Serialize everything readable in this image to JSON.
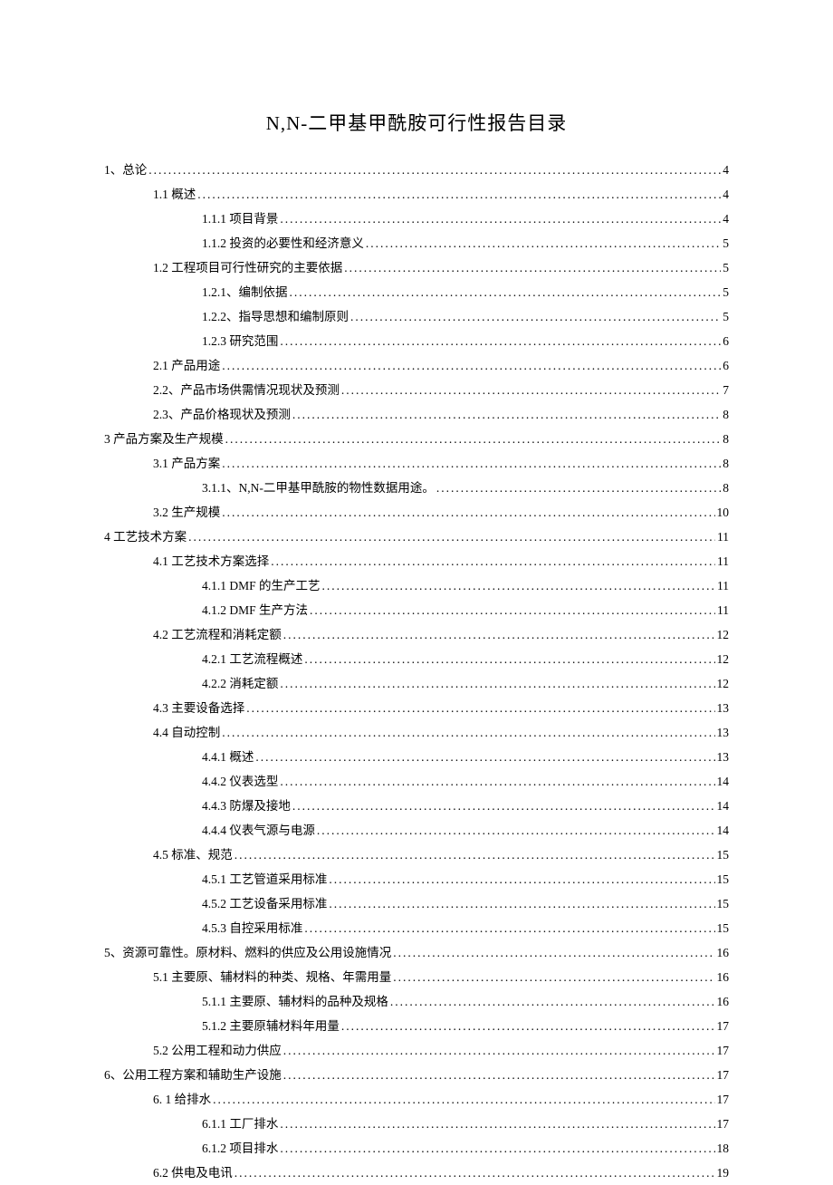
{
  "title": "N,N-二甲基甲酰胺可行性报告目录",
  "toc": [
    {
      "level": 0,
      "label": "1、总论",
      "page": "4"
    },
    {
      "level": 1,
      "label": "1.1 概述",
      "page": "4"
    },
    {
      "level": 2,
      "label": "1.1.1 项目背景",
      "page": "4"
    },
    {
      "level": 2,
      "label": "1.1.2 投资的必要性和经济意义",
      "page": "5"
    },
    {
      "level": 1,
      "label": "1.2 工程项目可行性研究的主要依据",
      "page": "5"
    },
    {
      "level": 2,
      "label": "1.2.1、编制依据",
      "page": "5"
    },
    {
      "level": 2,
      "label": "1.2.2、指导思想和编制原则",
      "page": "5"
    },
    {
      "level": 2,
      "label": "1.2.3  研究范围",
      "page": "6"
    },
    {
      "level": 1,
      "label": "2.1 产品用途",
      "page": "6"
    },
    {
      "level": 1,
      "label": "2.2、产品市场供需情况现状及预测",
      "page": "7"
    },
    {
      "level": 1,
      "label": "2.3、产品价格现状及预测",
      "page": "8"
    },
    {
      "level": 0,
      "label": "3 产品方案及生产规模",
      "page": "8"
    },
    {
      "level": 1,
      "label": "3.1 产品方案",
      "page": "8"
    },
    {
      "level": 2,
      "label": "3.1.1、N,N-二甲基甲酰胺的物性数据用途。",
      "page": "8"
    },
    {
      "level": 1,
      "label": "3.2 生产规模",
      "page": "10"
    },
    {
      "level": 0,
      "label": "4 工艺技术方案",
      "page": "11"
    },
    {
      "level": 1,
      "label": "4.1  工艺技术方案选择",
      "page": "11"
    },
    {
      "level": 2,
      "label": "4.1.1 DMF  的生产工艺",
      "page": "11"
    },
    {
      "level": 2,
      "label": "4.1.2 DMF  生产方法",
      "page": "11"
    },
    {
      "level": 1,
      "label": "4.2  工艺流程和消耗定额",
      "page": "12"
    },
    {
      "level": 2,
      "label": "4.2.1  工艺流程概述",
      "page": "12"
    },
    {
      "level": 2,
      "label": "4.2.2  消耗定额",
      "page": "12"
    },
    {
      "level": 1,
      "label": "4.3  主要设备选择",
      "page": "13"
    },
    {
      "level": 1,
      "label": "4.4  自动控制",
      "page": "13"
    },
    {
      "level": 2,
      "label": "4.4.1  概述",
      "page": "13"
    },
    {
      "level": 2,
      "label": "4.4.2  仪表选型",
      "page": "14"
    },
    {
      "level": 2,
      "label": "4.4.3  防爆及接地",
      "page": "14"
    },
    {
      "level": 2,
      "label": "4.4.4  仪表气源与电源",
      "page": "14"
    },
    {
      "level": 1,
      "label": "4.5  标准、规范",
      "page": "15"
    },
    {
      "level": 2,
      "label": "4.5.1  工艺管道采用标准",
      "page": "15"
    },
    {
      "level": 2,
      "label": "4.5.2  工艺设备采用标准",
      "page": "15"
    },
    {
      "level": 2,
      "label": "4.5.3  自控采用标准",
      "page": "15"
    },
    {
      "level": 0,
      "label": "5、资源可靠性。原材料、燃料的供应及公用设施情况",
      "page": "16"
    },
    {
      "level": 1,
      "label": "5.1  主要原、辅材料的种类、规格、年需用量",
      "page": "16"
    },
    {
      "level": 2,
      "label": "5.1.1  主要原、辅材料的品种及规格",
      "page": "16"
    },
    {
      "level": 2,
      "label": "5.1.2  主要原辅材料年用量",
      "page": "17"
    },
    {
      "level": 1,
      "label": "5.2  公用工程和动力供应",
      "page": "17"
    },
    {
      "level": 0,
      "label": "6、公用工程方案和辅助生产设施",
      "page": "17"
    },
    {
      "level": 1,
      "label": "6. 1  给排水",
      "page": "17"
    },
    {
      "level": 2,
      "label": "6.1.1  工厂排水",
      "page": "17"
    },
    {
      "level": 2,
      "label": "6.1.2  项目排水",
      "page": "18"
    },
    {
      "level": 1,
      "label": "6.2  供电及电讯",
      "page": "19"
    }
  ]
}
